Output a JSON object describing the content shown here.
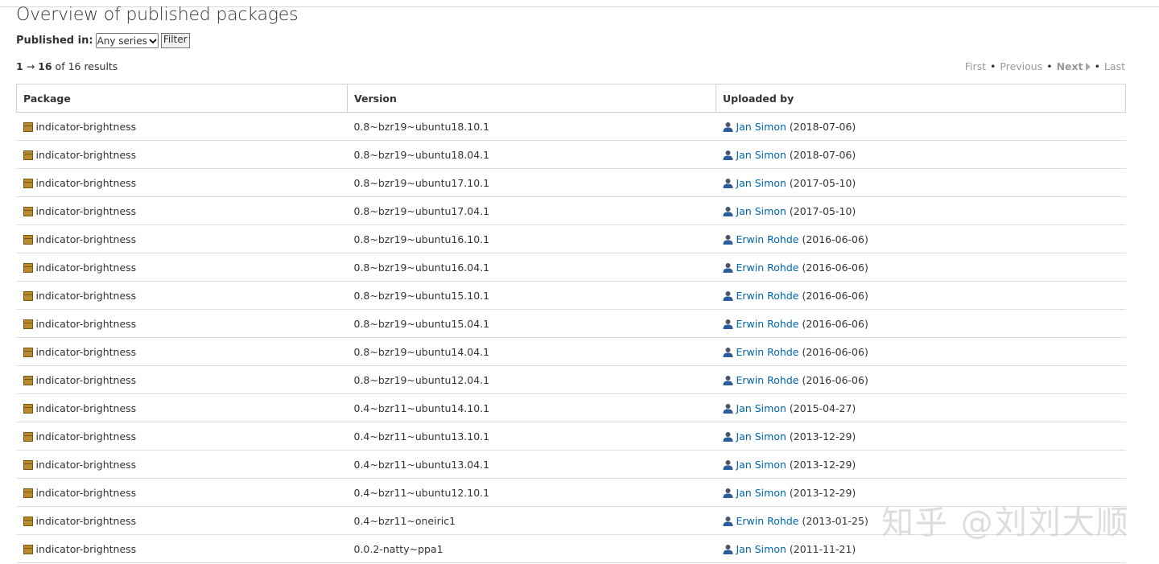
{
  "page": {
    "title": "Overview of published packages"
  },
  "filter": {
    "label": "Published in:",
    "selected_series": "Any series",
    "button_label": "Filter"
  },
  "results": {
    "start": "1",
    "arrow": "→",
    "end": "16",
    "of_text": "of 16 results"
  },
  "pager": {
    "first": "First",
    "previous": "Previous",
    "next": "Next",
    "last": "Last"
  },
  "table": {
    "headers": [
      "Package",
      "Version",
      "Uploaded by"
    ],
    "rows": [
      {
        "package": "indicator-brightness",
        "version": "0.8~bzr19~ubuntu18.10.1",
        "uploader": "Jan Simon",
        "date": "(2018-07-06)"
      },
      {
        "package": "indicator-brightness",
        "version": "0.8~bzr19~ubuntu18.04.1",
        "uploader": "Jan Simon",
        "date": "(2018-07-06)"
      },
      {
        "package": "indicator-brightness",
        "version": "0.8~bzr19~ubuntu17.10.1",
        "uploader": "Jan Simon",
        "date": "(2017-05-10)"
      },
      {
        "package": "indicator-brightness",
        "version": "0.8~bzr19~ubuntu17.04.1",
        "uploader": "Jan Simon",
        "date": "(2017-05-10)"
      },
      {
        "package": "indicator-brightness",
        "version": "0.8~bzr19~ubuntu16.10.1",
        "uploader": "Erwin Rohde",
        "date": "(2016-06-06)"
      },
      {
        "package": "indicator-brightness",
        "version": "0.8~bzr19~ubuntu16.04.1",
        "uploader": "Erwin Rohde",
        "date": "(2016-06-06)"
      },
      {
        "package": "indicator-brightness",
        "version": "0.8~bzr19~ubuntu15.10.1",
        "uploader": "Erwin Rohde",
        "date": "(2016-06-06)"
      },
      {
        "package": "indicator-brightness",
        "version": "0.8~bzr19~ubuntu15.04.1",
        "uploader": "Erwin Rohde",
        "date": "(2016-06-06)"
      },
      {
        "package": "indicator-brightness",
        "version": "0.8~bzr19~ubuntu14.04.1",
        "uploader": "Erwin Rohde",
        "date": "(2016-06-06)"
      },
      {
        "package": "indicator-brightness",
        "version": "0.8~bzr19~ubuntu12.04.1",
        "uploader": "Erwin Rohde",
        "date": "(2016-06-06)"
      },
      {
        "package": "indicator-brightness",
        "version": "0.4~bzr11~ubuntu14.10.1",
        "uploader": "Jan Simon",
        "date": "(2015-04-27)"
      },
      {
        "package": "indicator-brightness",
        "version": "0.4~bzr11~ubuntu13.10.1",
        "uploader": "Jan Simon",
        "date": "(2013-12-29)"
      },
      {
        "package": "indicator-brightness",
        "version": "0.4~bzr11~ubuntu13.04.1",
        "uploader": "Jan Simon",
        "date": "(2013-12-29)"
      },
      {
        "package": "indicator-brightness",
        "version": "0.4~bzr11~ubuntu12.10.1",
        "uploader": "Jan Simon",
        "date": "(2013-12-29)"
      },
      {
        "package": "indicator-brightness",
        "version": "0.4~bzr11~oneiric1",
        "uploader": "Erwin Rohde",
        "date": "(2013-01-25)"
      },
      {
        "package": "indicator-brightness",
        "version": "0.0.2-natty~ppa1",
        "uploader": "Jan Simon",
        "date": "(2011-11-21)"
      }
    ]
  },
  "watermark": {
    "text": "知乎 @刘刘大顺"
  },
  "colors": {
    "link": "#0066aa",
    "package_icon": "#b88a2e",
    "border": "#d2d2d2"
  },
  "icons": {
    "package": "package-icon",
    "person": "person-icon"
  }
}
